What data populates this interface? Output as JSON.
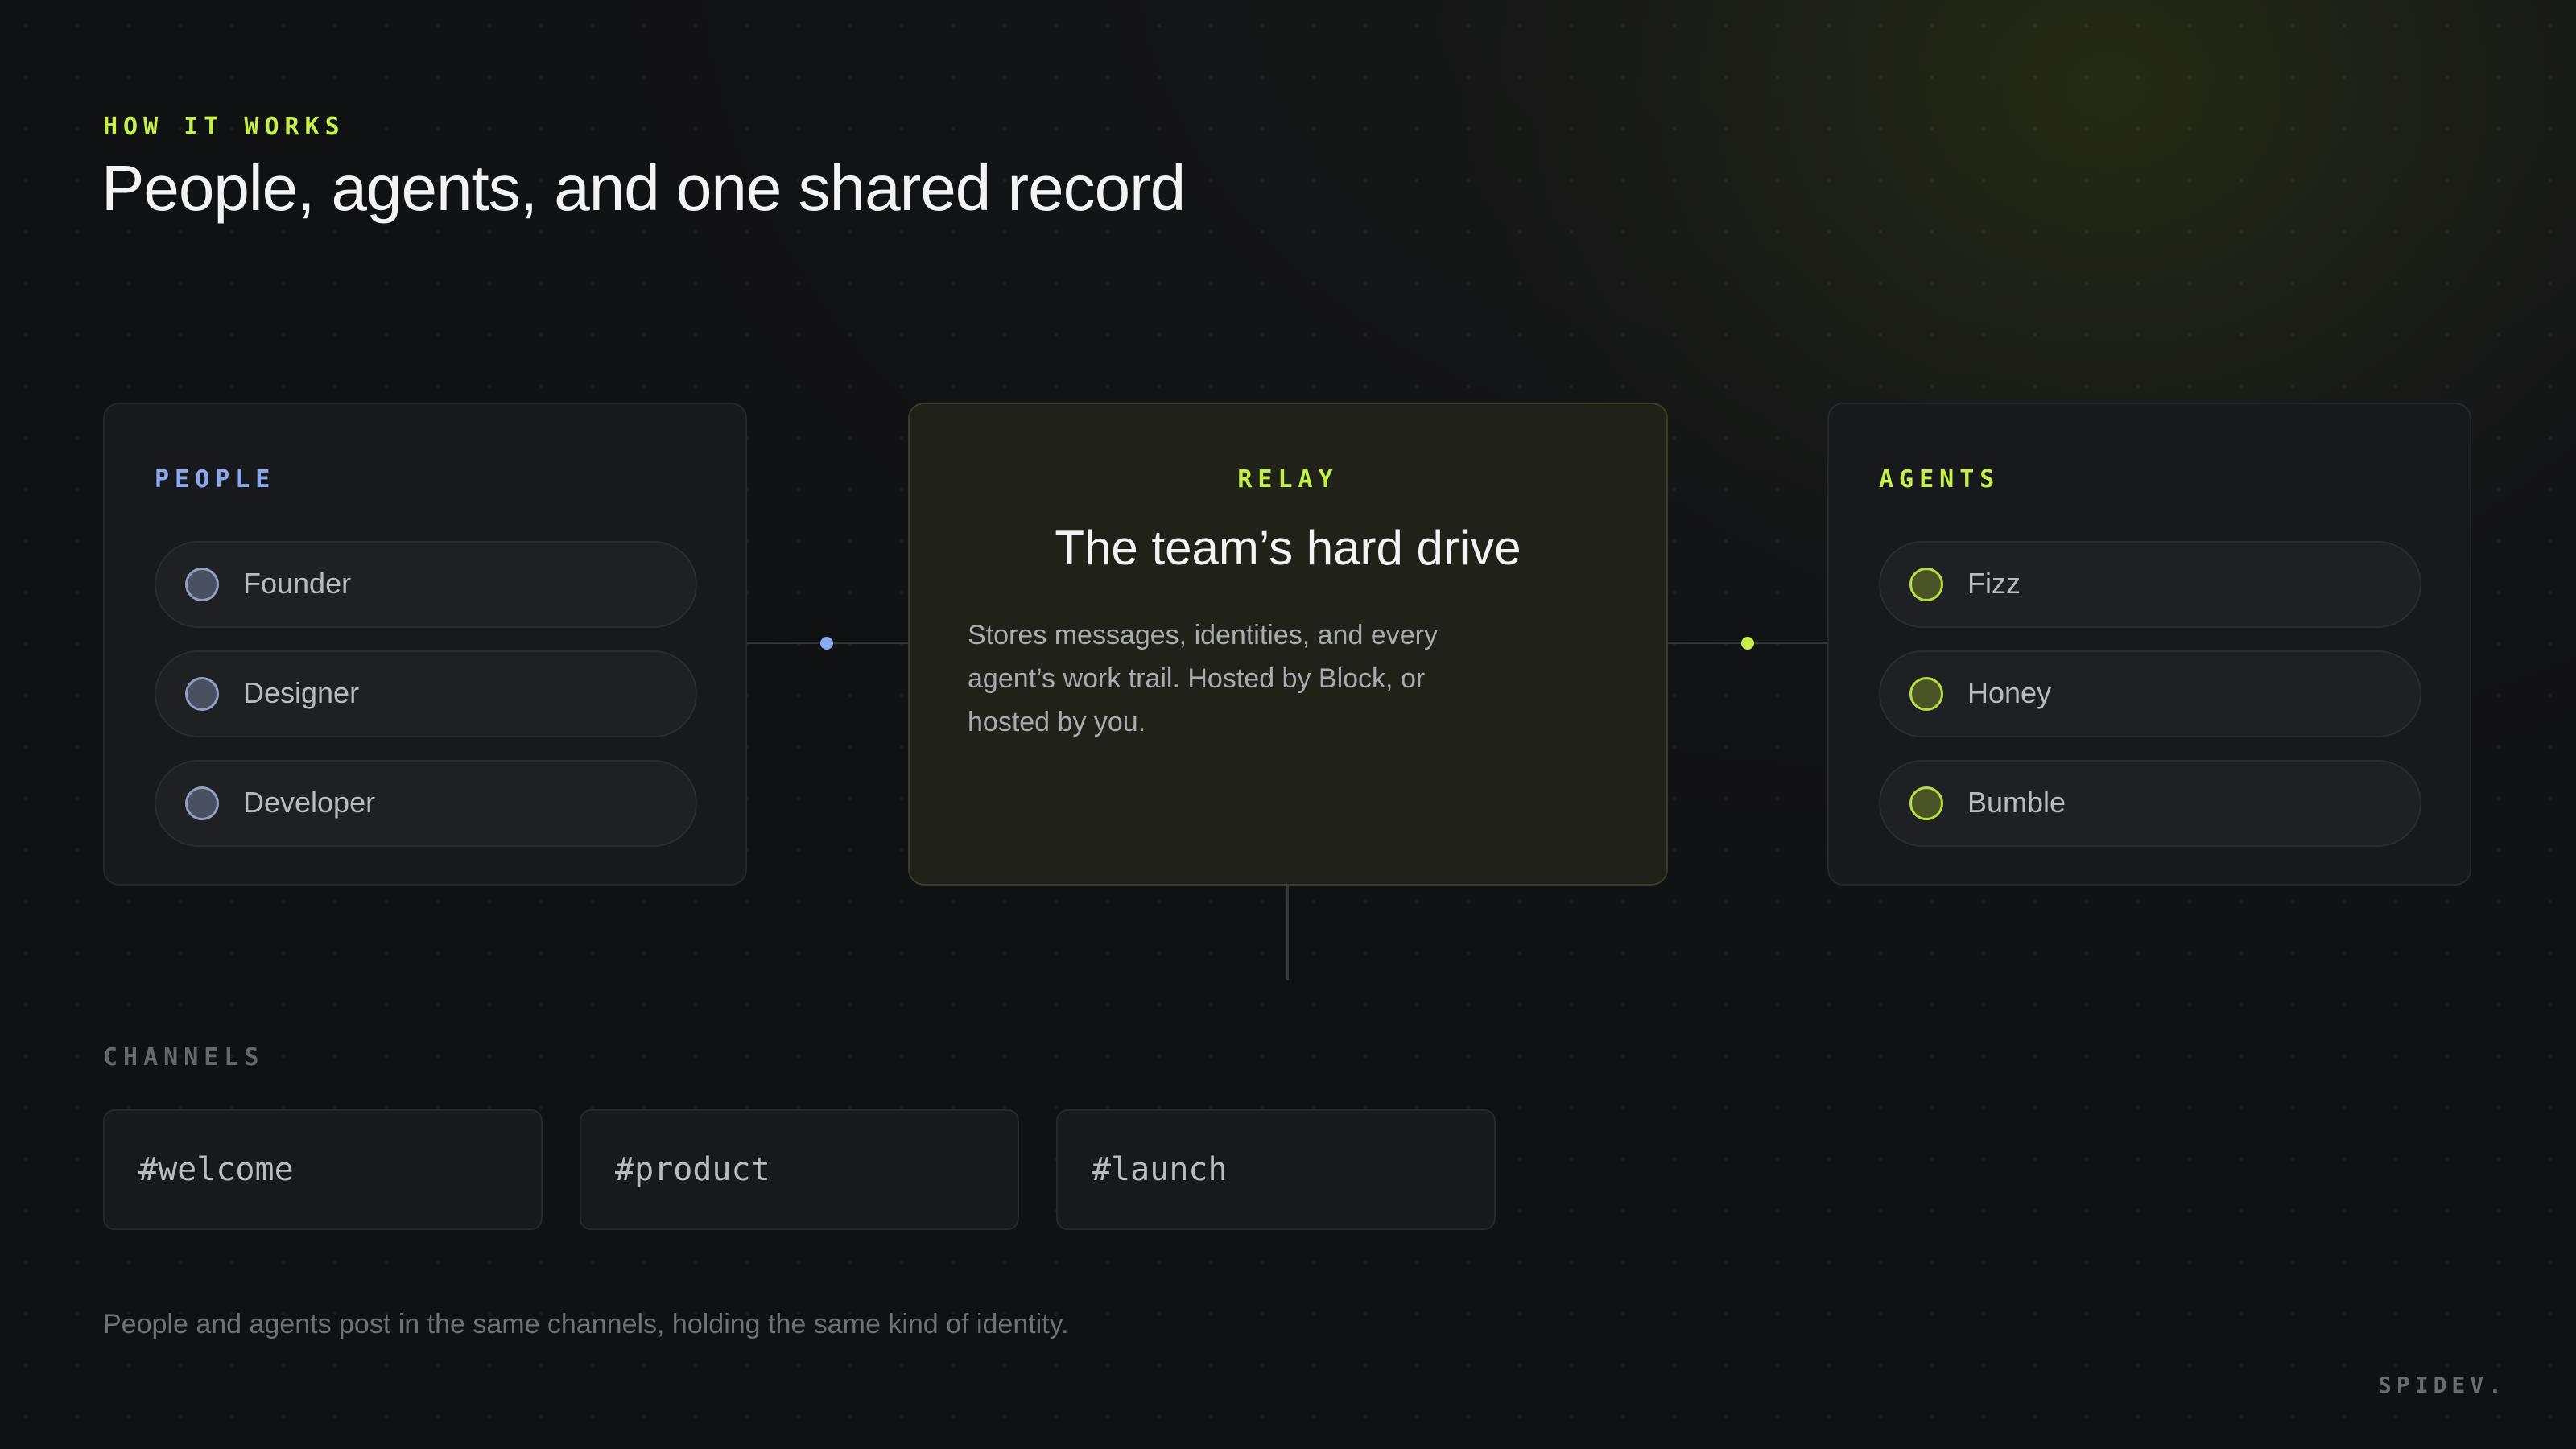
{
  "header": {
    "eyebrow": "HOW IT WORKS",
    "title": "People, agents, and one shared record"
  },
  "people": {
    "label": "PEOPLE",
    "items": [
      {
        "label": "Founder"
      },
      {
        "label": "Designer"
      },
      {
        "label": "Developer"
      }
    ]
  },
  "relay": {
    "label": "RELAY",
    "title": "The team’s hard drive",
    "body": "Stores messages, identities, and every agent’s work trail. Hosted by Block, or hosted by you."
  },
  "agents": {
    "label": "AGENTS",
    "items": [
      {
        "label": "Fizz"
      },
      {
        "label": "Honey"
      },
      {
        "label": "Bumble"
      }
    ]
  },
  "channels": {
    "label": "CHANNELS",
    "items": [
      {
        "label": "#welcome"
      },
      {
        "label": "#product"
      },
      {
        "label": "#launch"
      }
    ]
  },
  "footnote": "People and agents post in the same channels, holding the same kind of identity.",
  "brand": "SPIDEV.",
  "colors": {
    "accent_lime": "#c7ef4a",
    "people_blue": "#8aa9f0",
    "background": "#101113"
  }
}
